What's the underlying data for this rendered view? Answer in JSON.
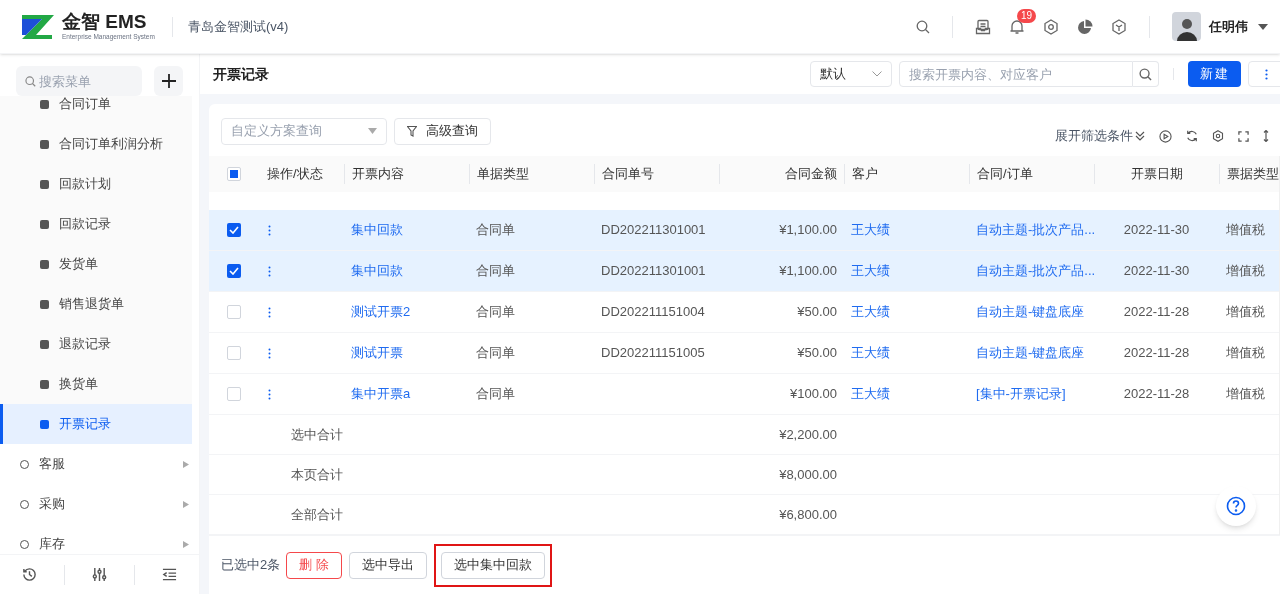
{
  "header": {
    "logo_text": "金智 EMS",
    "logo_subtitle": "Enterprise Management System",
    "company": "青岛金智测试(v4)",
    "notification_count": "19",
    "user_name": "任明伟"
  },
  "sidebar": {
    "search_placeholder": "搜索菜单",
    "sub_items": [
      {
        "label": "合同订单",
        "selected": false
      },
      {
        "label": "合同订单利润分析",
        "selected": false
      },
      {
        "label": "回款计划",
        "selected": false
      },
      {
        "label": "回款记录",
        "selected": false
      },
      {
        "label": "发货单",
        "selected": false
      },
      {
        "label": "销售退货单",
        "selected": false
      },
      {
        "label": "退款记录",
        "selected": false
      },
      {
        "label": "换货单",
        "selected": false
      },
      {
        "label": "开票记录",
        "selected": true
      }
    ],
    "groups": [
      {
        "label": "客服",
        "expanded": false
      },
      {
        "label": "采购",
        "expanded": false
      },
      {
        "label": "库存",
        "expanded": false
      }
    ]
  },
  "page": {
    "title": "开票记录",
    "view_select": "默认",
    "search_placeholder": "搜索开票内容、对应客户",
    "new_button": "新建"
  },
  "toolbar": {
    "scheme_placeholder": "自定义方案查询",
    "advanced_button": "高级查询",
    "expand_filters": "展开筛选条件"
  },
  "table": {
    "select_all_indeterminate": true,
    "columns": [
      "操作/状态",
      "开票内容",
      "单据类型",
      "合同单号",
      "合同金额",
      "客户",
      "合同/订单",
      "开票日期",
      "票据类型"
    ],
    "rows": [
      {
        "selected": true,
        "content": "集中回款",
        "doc_type": "合同单",
        "contract_no": "DD202211301001",
        "amount": "¥1,100.00",
        "customer": "王大绩",
        "order": "自动主题-批次产品...",
        "date": "2022-11-30",
        "ticket_type": "增值税"
      },
      {
        "selected": true,
        "content": "集中回款",
        "doc_type": "合同单",
        "contract_no": "DD202211301001",
        "amount": "¥1,100.00",
        "customer": "王大绩",
        "order": "自动主题-批次产品...",
        "date": "2022-11-30",
        "ticket_type": "增值税"
      },
      {
        "selected": false,
        "content": "测试开票2",
        "doc_type": "合同单",
        "contract_no": "DD202211151004",
        "amount": "¥50.00",
        "customer": "王大绩",
        "order": "自动主题-键盘底座",
        "date": "2022-11-28",
        "ticket_type": "增值税"
      },
      {
        "selected": false,
        "content": "测试开票",
        "doc_type": "合同单",
        "contract_no": "DD202211151005",
        "amount": "¥50.00",
        "customer": "王大绩",
        "order": "自动主题-键盘底座",
        "date": "2022-11-28",
        "ticket_type": "增值税"
      },
      {
        "selected": false,
        "content": "集中开票a",
        "doc_type": "合同单",
        "amount": "¥100.00",
        "customer": "王大绩",
        "order": "[集中-开票记录]",
        "date": "2022-11-28",
        "ticket_type": "增值税"
      }
    ],
    "totals": [
      {
        "label": "选中合计",
        "amount": "¥2,200.00"
      },
      {
        "label": "本页合计",
        "amount": "¥8,000.00"
      },
      {
        "label": "全部合计",
        "amount": "¥6,800.00"
      }
    ]
  },
  "footer": {
    "selected_count": "已选中2条",
    "buttons": [
      {
        "label": "删 除",
        "kind": "danger",
        "highlighted": false
      },
      {
        "label": "选中导出",
        "kind": "default",
        "highlighted": false
      },
      {
        "label": "选中集中回款",
        "kind": "default",
        "highlighted": true
      }
    ]
  }
}
